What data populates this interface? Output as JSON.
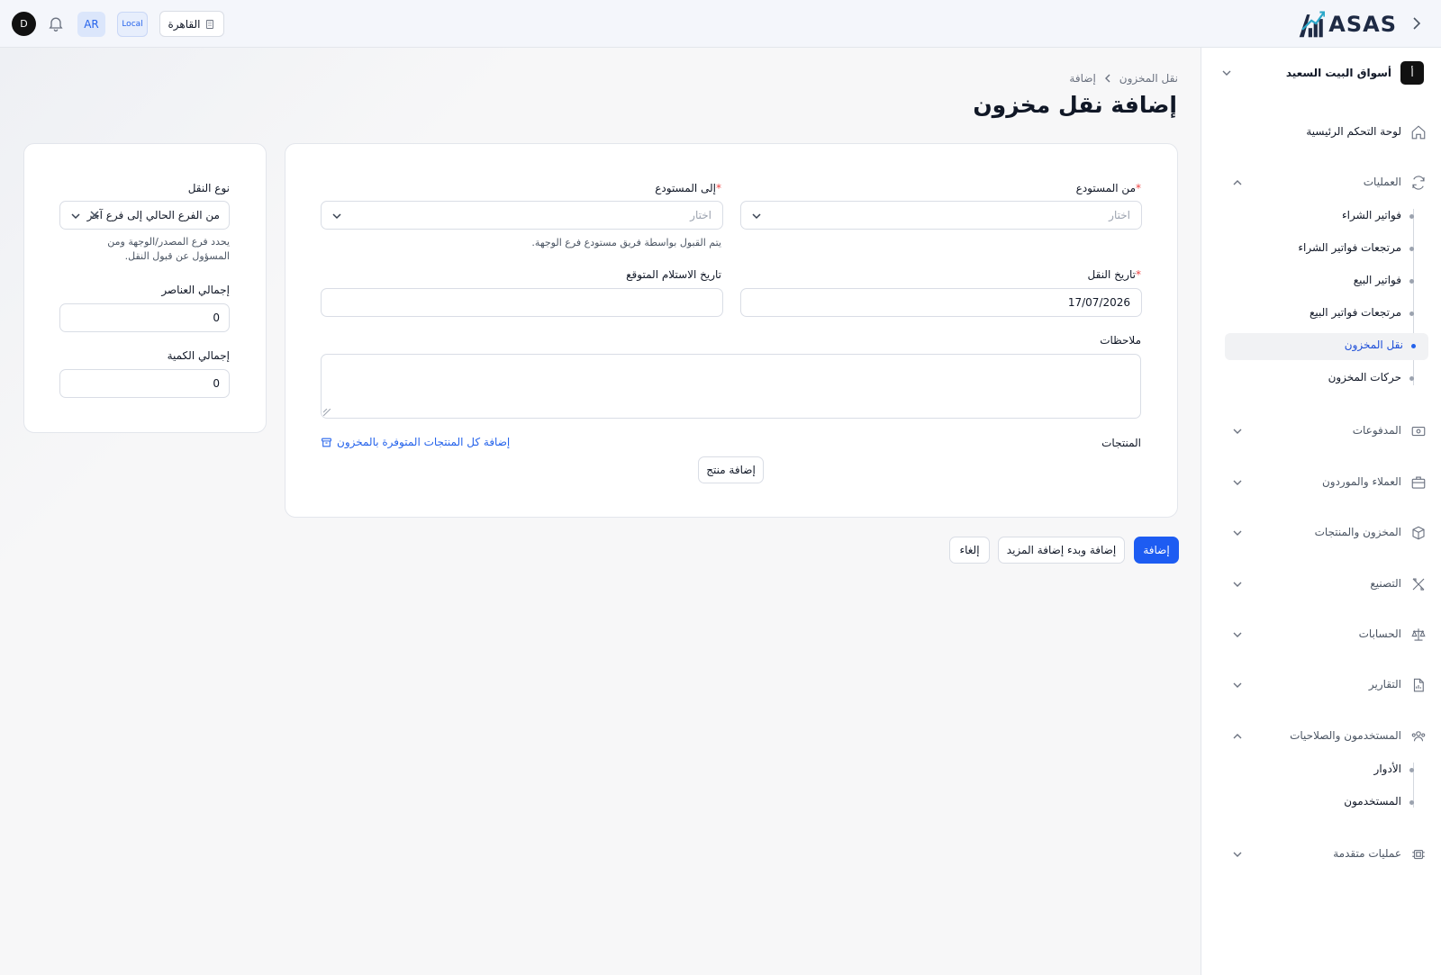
{
  "topbar": {
    "user_initial": "D",
    "language": "AR",
    "environment": "Local",
    "branch": "القاهرة",
    "logo_text": "ASAS"
  },
  "sidebar": {
    "organization": "أسواق البيت السعيد",
    "organization_logo_letter": "أ",
    "dashboard": "لوحة التحكم الرئيسية",
    "operations": {
      "label": "العمليات",
      "items": [
        {
          "label": "فواتير الشراء"
        },
        {
          "label": "مرتجعات فواتير الشراء"
        },
        {
          "label": "فواتير البيع"
        },
        {
          "label": "مرتجعات فواتير البيع"
        },
        {
          "label": "نقل المخزون"
        },
        {
          "label": "حركات المخزون"
        }
      ]
    },
    "payments": "المدفوعات",
    "customers_suppliers": "العملاء والموردون",
    "inventory_products": "المخزون والمنتجات",
    "manufacturing": "التصنيع",
    "accounts": "الحسابات",
    "reports": "التقارير",
    "users_permissions": {
      "label": "المستخدمون والصلاحيات",
      "items": [
        {
          "label": "الأدوار"
        },
        {
          "label": "المستخدمون"
        }
      ]
    },
    "advanced": "عمليات متقدمة"
  },
  "breadcrumb": {
    "parent": "نقل المخزون",
    "current": "إضافة"
  },
  "page_title": "إضافة نقل مخزون",
  "form": {
    "from_warehouse": {
      "label": "من المستودع",
      "required_mark": "*",
      "placeholder": "اختار"
    },
    "to_warehouse": {
      "label": "إلى المستودع",
      "required_mark": "*",
      "placeholder": "اختار",
      "helper": "يتم القبول بواسطة فريق مستودع فرع الوجهة."
    },
    "transfer_date": {
      "label": "تاريخ النقل",
      "required_mark": "*",
      "value": "17/07/2026"
    },
    "expected_date": {
      "label": "تاريخ الاستلام المتوقع",
      "value": ""
    },
    "notes": {
      "label": "ملاحظات",
      "value": ""
    },
    "products": {
      "label": "المنتجات",
      "add_all_link": "إضافة كل المنتجات المتوفرة بالمخزون",
      "add_button": "إضافة منتج"
    }
  },
  "side_panel": {
    "transfer_type": {
      "label": "نوع النقل",
      "value": "من الفرع الحالي إلى فرع آخر",
      "helper_line1": "يحدد فرع المصدر/الوجهة ومن",
      "helper_line2": "المسؤول عن قبول النقل."
    },
    "total_items": {
      "label": "إجمالي العناصر",
      "value": "0"
    },
    "total_quantity": {
      "label": "إجمالي الكمية",
      "value": "0"
    }
  },
  "actions": {
    "submit": "إضافة",
    "submit_and_more": "إضافة وبدء إضافة المزيد",
    "cancel": "إلغاء"
  },
  "colors": {
    "primary": "#1d5cf2",
    "active_text": "#1d4ed8",
    "required": "#ef4444"
  }
}
